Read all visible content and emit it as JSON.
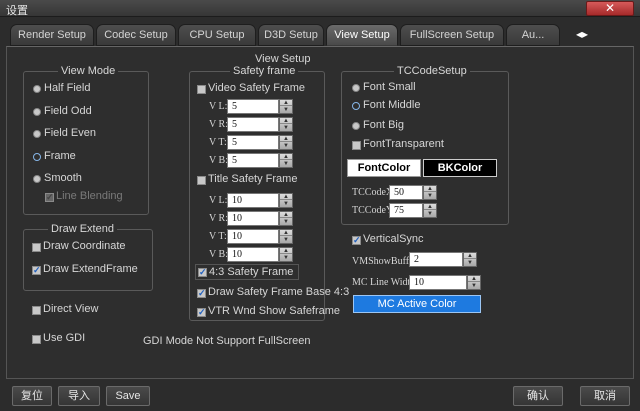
{
  "window": {
    "title": "设置",
    "close_glyph": "✕"
  },
  "tabs": [
    {
      "label": "Render Setup",
      "active": false
    },
    {
      "label": "Codec Setup",
      "active": false
    },
    {
      "label": "CPU Setup",
      "active": false
    },
    {
      "label": "D3D Setup",
      "active": false
    },
    {
      "label": "View Setup",
      "active": true
    },
    {
      "label": "FullScreen Setup",
      "active": false
    },
    {
      "label": "Au...",
      "active": false
    }
  ],
  "tab_scroll_glyph": "◂▸",
  "panel": {
    "title": "View Setup"
  },
  "view_mode": {
    "title": "View Mode",
    "options": [
      "Half Field",
      "Field Odd",
      "Field Even",
      "Frame",
      "Smooth"
    ],
    "selected": "Frame",
    "line_blending": {
      "label": "Line Blending",
      "checked": true,
      "enabled": false
    }
  },
  "draw_extend": {
    "title": "Draw Extend",
    "draw_coordinate": {
      "label": "Draw Coordinate",
      "checked": false
    },
    "draw_extend_frame": {
      "label": "Draw ExtendFrame",
      "checked": true
    }
  },
  "direct_view": {
    "label": "Direct View",
    "checked": false
  },
  "use_gdi": {
    "label": "Use GDI",
    "checked": false
  },
  "gdi_note": "GDI Mode Not Support FullScreen",
  "safety_frame": {
    "title": "Safety frame",
    "video": {
      "label": "Video Safety Frame",
      "checked": false,
      "fields": [
        {
          "label": "V L:",
          "value": "5"
        },
        {
          "label": "V R:",
          "value": "5"
        },
        {
          "label": "V T:",
          "value": "5"
        },
        {
          "label": "V B:",
          "value": "5"
        }
      ]
    },
    "title_frame": {
      "label": "Title Safety Frame",
      "checked": false,
      "fields": [
        {
          "label": "V L:",
          "value": "10"
        },
        {
          "label": "V R:",
          "value": "10"
        },
        {
          "label": "V T:",
          "value": "10"
        },
        {
          "label": "V B:",
          "value": "10"
        }
      ]
    },
    "four_three": {
      "label": "4:3 Safety Frame",
      "checked": true
    },
    "draw_base": {
      "label": "Draw Safety Frame Base 4:3",
      "checked": true
    },
    "vtr_show": {
      "label": "VTR Wnd Show Safeframe",
      "checked": true
    }
  },
  "tccode": {
    "title": "TCCodeSetup",
    "options": [
      "Font Small",
      "Font Middle",
      "Font Big"
    ],
    "selected": "Font Middle",
    "transparent": {
      "label": "FontTransparent",
      "checked": false
    },
    "font_color_label": "FontColor",
    "bk_color_label": "BKColor",
    "font_color": "#ffffff",
    "bk_color": "#000000",
    "x_label": "TCCodeX:",
    "x_value": "50",
    "y_label": "TCCodeY:",
    "y_value": "75"
  },
  "vertical_sync": {
    "label": "VerticalSync",
    "checked": true
  },
  "vm_show_buffer": {
    "label": "VMShowBuffer:",
    "value": "2"
  },
  "mc_line_width": {
    "label": "MC Line Width:",
    "value": "10"
  },
  "mc_active_color": {
    "label": "MC Active Color",
    "color": "#1e7ae0"
  },
  "footer": {
    "reset": "复位",
    "import": "导入",
    "save": "Save",
    "ok": "确认",
    "cancel": "取消"
  }
}
